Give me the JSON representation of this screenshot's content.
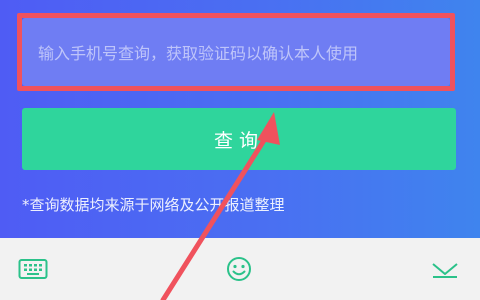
{
  "search": {
    "placeholder": "输入手机号查询，获取验证码以确认本人使用"
  },
  "query_button": {
    "label": "查询"
  },
  "note": {
    "text": "*查询数据均来源于网络及公开报道整理"
  },
  "keyboard_bar": {
    "icons": [
      "keyboard-icon",
      "emoji-icon",
      "collapse-icon"
    ]
  },
  "colors": {
    "background_gradient_start": "#4f5cf4",
    "background_gradient_end": "#3f84ee",
    "button": "#2fd59c",
    "annotation": "#f0525d",
    "keyboard_icon": "#2bc28a"
  }
}
